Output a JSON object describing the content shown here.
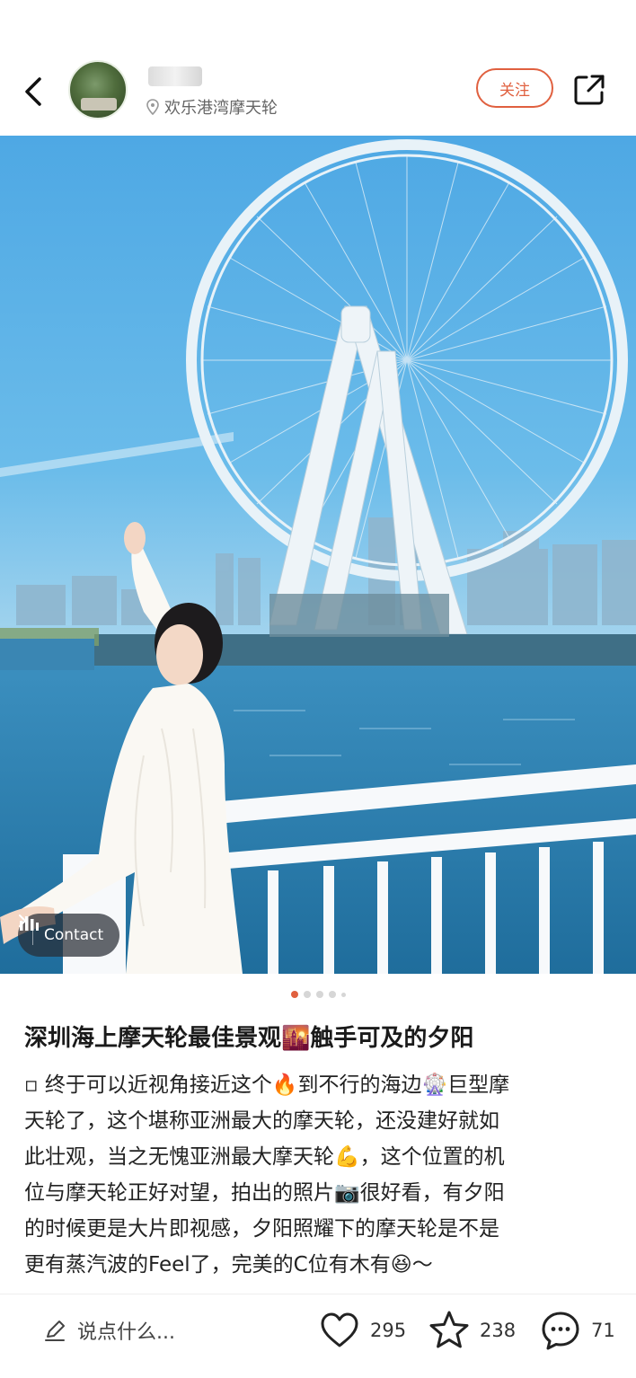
{
  "header": {
    "location": "欢乐港湾摩天轮",
    "follow_label": "关注"
  },
  "icons": {
    "back": "chevron-left-icon",
    "location": "location-pin-icon",
    "share": "share-icon",
    "contact": "bars-icon",
    "like": "heart-icon",
    "collect": "star-icon",
    "comment": "comment-icon",
    "edit": "pencil-icon"
  },
  "photo": {
    "contact_label": "Contact",
    "pager_total": 5,
    "pager_active": 1
  },
  "post": {
    "title": "深圳海上摩天轮最佳景观🌇触手可及的夕阳",
    "body_lines": [
      "▫ 终于可以近视角接近这个🔥到不行的海边🎡巨型摩",
      "天轮了，这个堪称亚洲最大的摩天轮，还没建好就如",
      "此壮观，当之无愧亚洲最大摩天轮💪，这个位置的机",
      "位与摩天轮正好对望，拍出的照片📷很好看，有夕阳",
      "的时候更是大片即视感，夕阳照耀下的摩天轮是不是",
      "更有蒸汽波的Feel了，完美的C位有木有😆～"
    ]
  },
  "bottom_bar": {
    "comment_placeholder": "说点什么...",
    "likes": "295",
    "collects": "238",
    "comments": "71"
  },
  "colors": {
    "accent": "#e0603f",
    "sky": "#4ea8e4",
    "sea": "#2f7fae"
  }
}
